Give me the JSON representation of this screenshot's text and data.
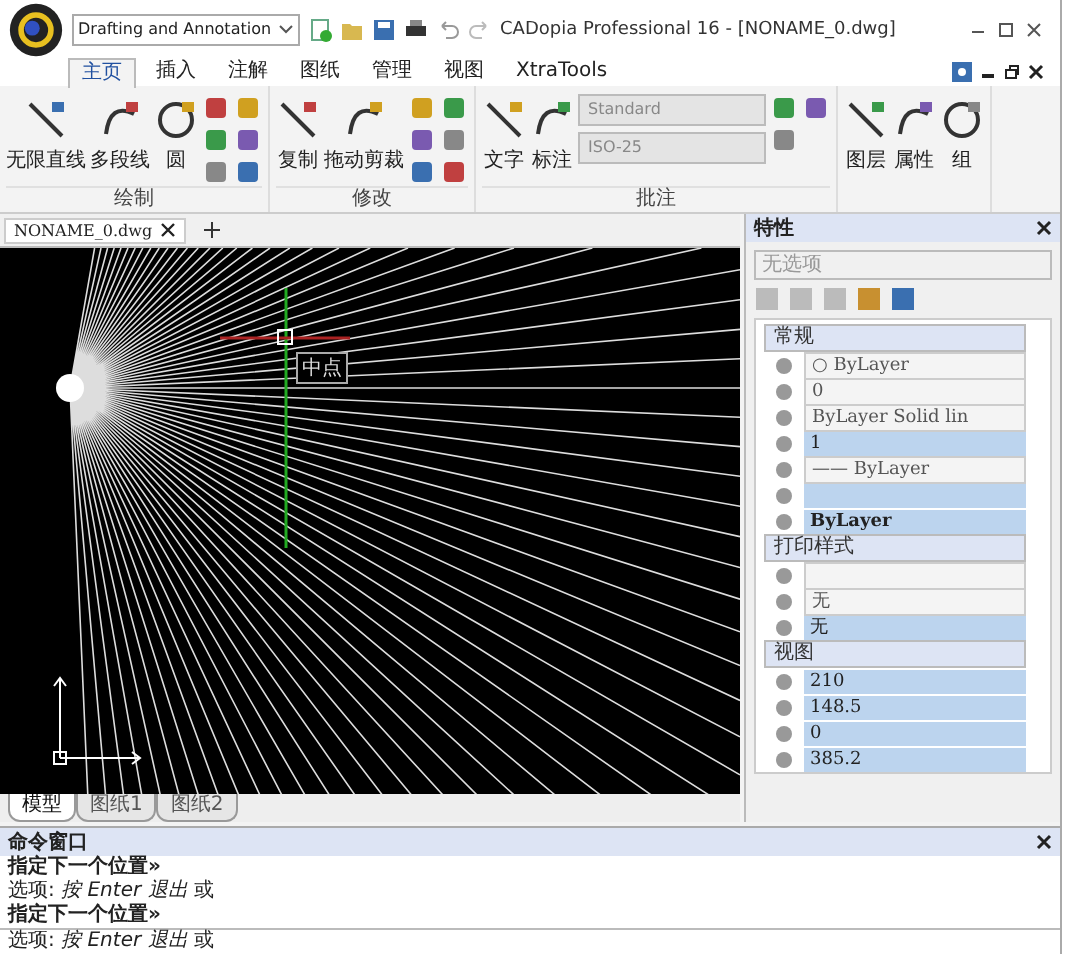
{
  "window": {
    "workspace": "Drafting and Annotation",
    "title": "CADopia Professional 16 - [NONAME_0.dwg]"
  },
  "ribbon_tabs": [
    {
      "label": "主页",
      "selected": true
    },
    {
      "label": "插入",
      "selected": false
    },
    {
      "label": "注解",
      "selected": false
    },
    {
      "label": "图纸",
      "selected": false
    },
    {
      "label": "管理",
      "selected": false
    },
    {
      "label": "视图",
      "selected": false
    },
    {
      "label": "XtraTools",
      "selected": false
    }
  ],
  "ribbon_groups": [
    {
      "title": "绘制",
      "tools": [
        "无限直线",
        "多段线",
        "圆"
      ]
    },
    {
      "title": "修改",
      "tools": [
        "复制",
        "拖动剪裁"
      ]
    },
    {
      "title": "批注",
      "tools": [
        "文字",
        "标注"
      ],
      "styles": [
        "Standard",
        "ISO-25"
      ]
    },
    {
      "tools": [
        "图层",
        "属性",
        "组"
      ]
    }
  ],
  "document_tabs": [
    {
      "label": "NONAME_0.dwg"
    }
  ],
  "canvas": {
    "snap_tooltip": "中点"
  },
  "layout_tabs": [
    {
      "label": "模型",
      "selected": true
    },
    {
      "label": "图纸1",
      "selected": false
    },
    {
      "label": "图纸2",
      "selected": false
    }
  ],
  "properties": {
    "title": "特性",
    "selection": "无选项",
    "sections": [
      {
        "title": "常规",
        "rows": [
          {
            "kind": "dropdown",
            "value": "○ ByLayer"
          },
          {
            "kind": "dropdown",
            "value": "0"
          },
          {
            "kind": "dropdown",
            "value": "ByLayer      Solid lin"
          },
          {
            "kind": "field",
            "value": "1"
          },
          {
            "kind": "dropdown",
            "value": "—— ByLayer"
          },
          {
            "kind": "field",
            "value": ""
          },
          {
            "kind": "field",
            "value": "**ByLayer**"
          }
        ]
      },
      {
        "title": "打印样式",
        "rows": [
          {
            "kind": "dropdown",
            "value": ""
          },
          {
            "kind": "dropdown",
            "value": "无"
          },
          {
            "kind": "field",
            "value": "无"
          }
        ]
      },
      {
        "title": "视图",
        "rows": [
          {
            "kind": "field",
            "value": "210"
          },
          {
            "kind": "field",
            "value": "148.5"
          },
          {
            "kind": "field",
            "value": "0"
          },
          {
            "kind": "field",
            "value": "385.2"
          }
        ]
      }
    ]
  },
  "command_window": {
    "title": "命令窗口",
    "lines": [
      "**指定下一个位置»**",
      "选项: *按 Enter 退出* 或",
      "**指定下一个位置»**"
    ],
    "input": "选项: *按 Enter 退出* 或"
  }
}
